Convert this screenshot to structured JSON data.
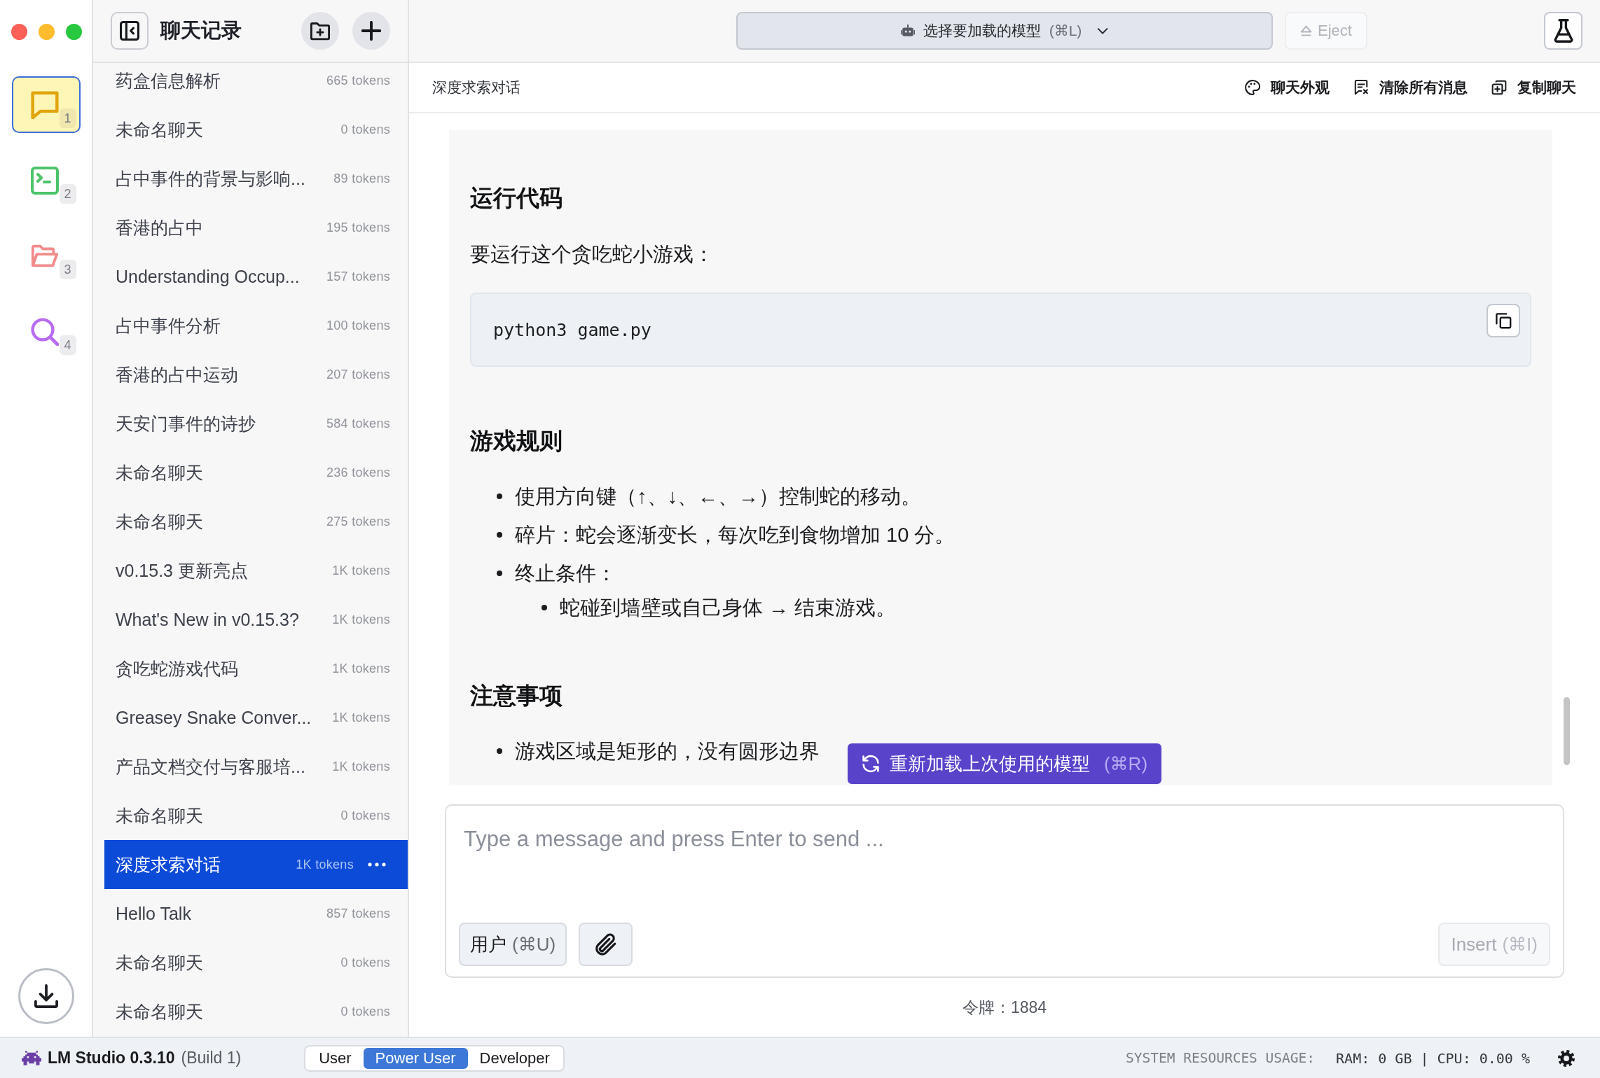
{
  "rail": {
    "items": [
      {
        "kind": "chat",
        "badge": "1",
        "selected": true
      },
      {
        "kind": "terminal",
        "badge": "2",
        "selected": false
      },
      {
        "kind": "folder",
        "badge": "3",
        "selected": false
      },
      {
        "kind": "search",
        "badge": "4",
        "selected": false
      }
    ]
  },
  "chat_list": {
    "title": "聊天记录",
    "items": [
      {
        "title": "药盒信息解析",
        "tokens": "665 tokens",
        "selected": false
      },
      {
        "title": "未命名聊天",
        "tokens": "0 tokens",
        "selected": false
      },
      {
        "title": "占中事件的背景与影响...",
        "tokens": "89 tokens",
        "selected": false
      },
      {
        "title": "香港的占中",
        "tokens": "195 tokens",
        "selected": false
      },
      {
        "title": "Understanding Occup...",
        "tokens": "157 tokens",
        "selected": false
      },
      {
        "title": "占中事件分析",
        "tokens": "100 tokens",
        "selected": false
      },
      {
        "title": "香港的占中运动",
        "tokens": "207 tokens",
        "selected": false
      },
      {
        "title": "天安门事件的诗抄",
        "tokens": "584 tokens",
        "selected": false
      },
      {
        "title": "未命名聊天",
        "tokens": "236 tokens",
        "selected": false
      },
      {
        "title": "未命名聊天",
        "tokens": "275 tokens",
        "selected": false
      },
      {
        "title": "v0.15.3 更新亮点",
        "tokens": "1K tokens",
        "selected": false
      },
      {
        "title": "What's New in v0.15.3?",
        "tokens": "1K tokens",
        "selected": false
      },
      {
        "title": "贪吃蛇游戏代码",
        "tokens": "1K tokens",
        "selected": false
      },
      {
        "title": "Greasey Snake Conver...",
        "tokens": "1K tokens",
        "selected": false
      },
      {
        "title": "产品文档交付与客服培...",
        "tokens": "1K tokens",
        "selected": false
      },
      {
        "title": "未命名聊天",
        "tokens": "0 tokens",
        "selected": false
      },
      {
        "title": "深度求索对话",
        "tokens": "1K tokens",
        "selected": true
      },
      {
        "title": "Hello Talk",
        "tokens": "857 tokens",
        "selected": false
      },
      {
        "title": "未命名聊天",
        "tokens": "0 tokens",
        "selected": false
      },
      {
        "title": "未命名聊天",
        "tokens": "0 tokens",
        "selected": false
      }
    ]
  },
  "top_bar": {
    "model_selector": {
      "label": "选择要加载的模型",
      "shortcut": "(⌘L)"
    },
    "eject": {
      "label": "Eject",
      "disabled": true
    }
  },
  "chat_header": {
    "title": "深度求索对话",
    "actions": [
      {
        "kind": "appearance",
        "label": "聊天外观"
      },
      {
        "kind": "clear",
        "label": "清除所有消息"
      },
      {
        "kind": "copy",
        "label": "复制聊天"
      }
    ]
  },
  "message": {
    "blocks": [
      {
        "kind": "heading",
        "text": "运行代码"
      },
      {
        "kind": "paragraph",
        "text": "要运行这个贪吃蛇小游戏："
      },
      {
        "kind": "code",
        "text": "python3 game.py"
      },
      {
        "kind": "heading",
        "text": "游戏规则"
      },
      {
        "kind": "list",
        "items": [
          {
            "text": "使用方向键（↑、↓、←、→）控制蛇的移动。"
          },
          {
            "text": "碎片：蛇会逐渐变长，每次吃到食物增加 10 分。"
          },
          {
            "text": "终止条件：",
            "children": [
              {
                "text": "蛇碰到墙壁或自己身体 → 结束游戏。"
              }
            ]
          }
        ]
      },
      {
        "kind": "heading",
        "text": "注意事项"
      },
      {
        "kind": "list",
        "items": [
          {
            "text": "游戏区域是矩形的，没有圆形边界"
          }
        ]
      }
    ]
  },
  "toast": {
    "label": "重新加载上次使用的模型",
    "shortcut": "(⌘R)"
  },
  "composer": {
    "placeholder": "Type a message and press Enter to send ...",
    "role_button": {
      "label": "用户",
      "shortcut": "(⌘U)"
    },
    "insert_button": {
      "label": "Insert",
      "shortcut": "(⌘I)",
      "disabled": true
    }
  },
  "token_count": "令牌：1884",
  "status_bar": {
    "app_name": "LM Studio 0.3.10",
    "build": "(Build 1)",
    "modes": [
      {
        "label": "User",
        "selected": false
      },
      {
        "label": "Power User",
        "selected": true
      },
      {
        "label": "Developer",
        "selected": false
      }
    ],
    "resources_label": "SYSTEM RESOURCES USAGE:",
    "resources": "RAM: 0 GB | CPU: 0.00 %"
  }
}
